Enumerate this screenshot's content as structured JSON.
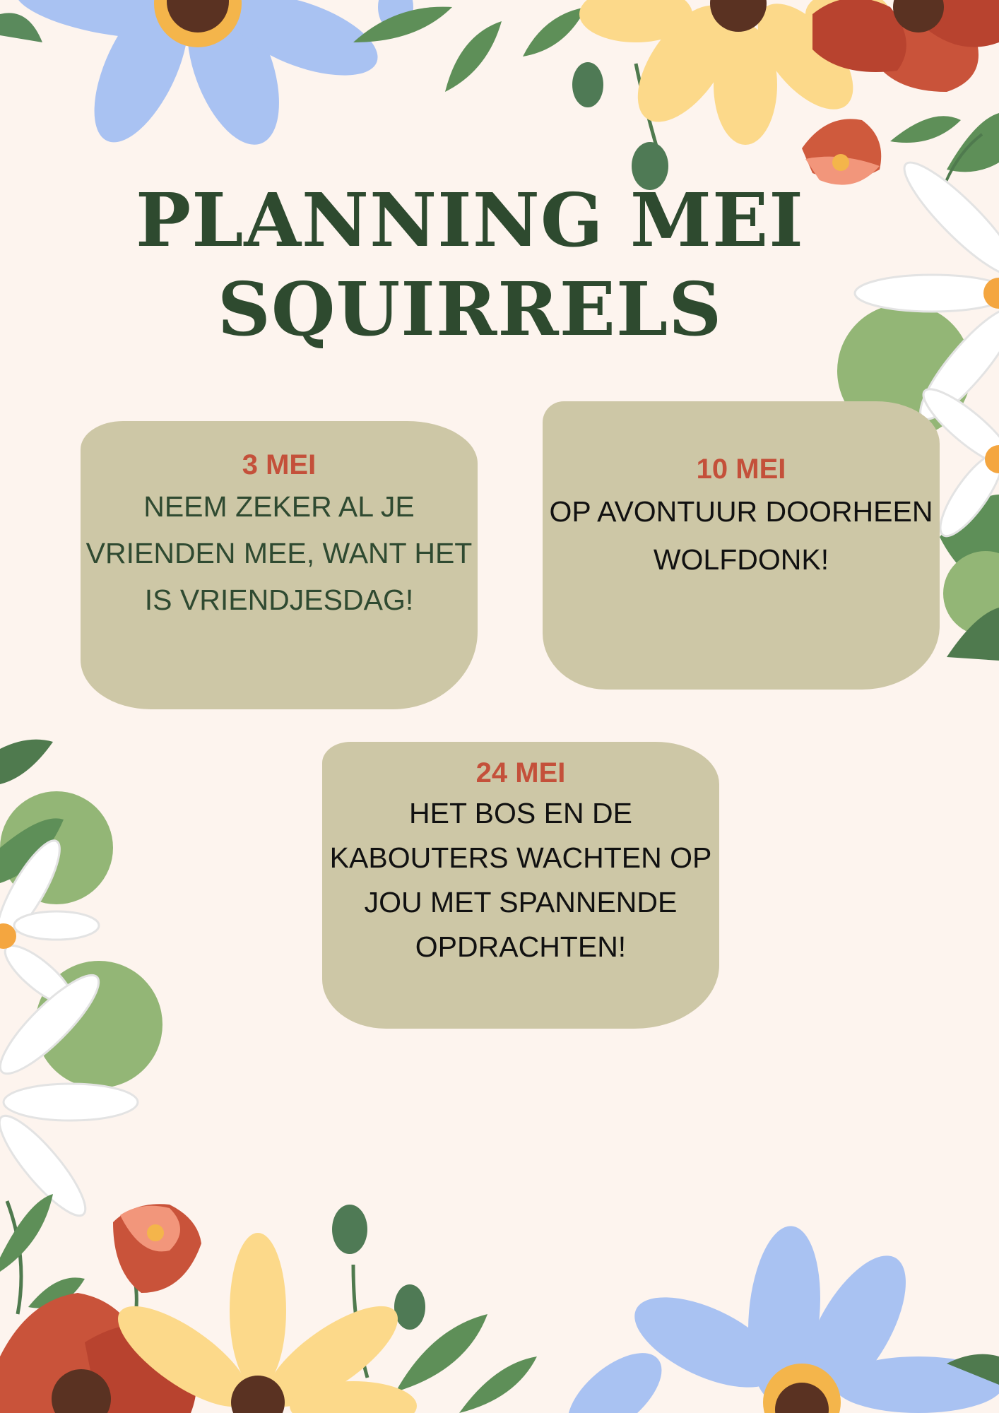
{
  "title": {
    "line1": "PLANNING MEI",
    "line2": "SQUIRRELS"
  },
  "events": [
    {
      "date": "3 MEI",
      "text": "NEEM ZEKER AL JE VRIENDEN MEE, WANT HET IS VRIENDJESDAG!"
    },
    {
      "date": "10 MEI",
      "text": "OP AVONTUUR DOORHEEN WOLFDONK!"
    },
    {
      "date": "24 MEI",
      "text": "HET BOS EN DE KABOUTERS WACHTEN OP JOU MET SPANNENDE OPDRACHTEN!"
    }
  ],
  "colors": {
    "background": "#fdf4ee",
    "title": "#2e4a2f",
    "card": "#cdc7a6",
    "date_accent": "#c4503a"
  }
}
